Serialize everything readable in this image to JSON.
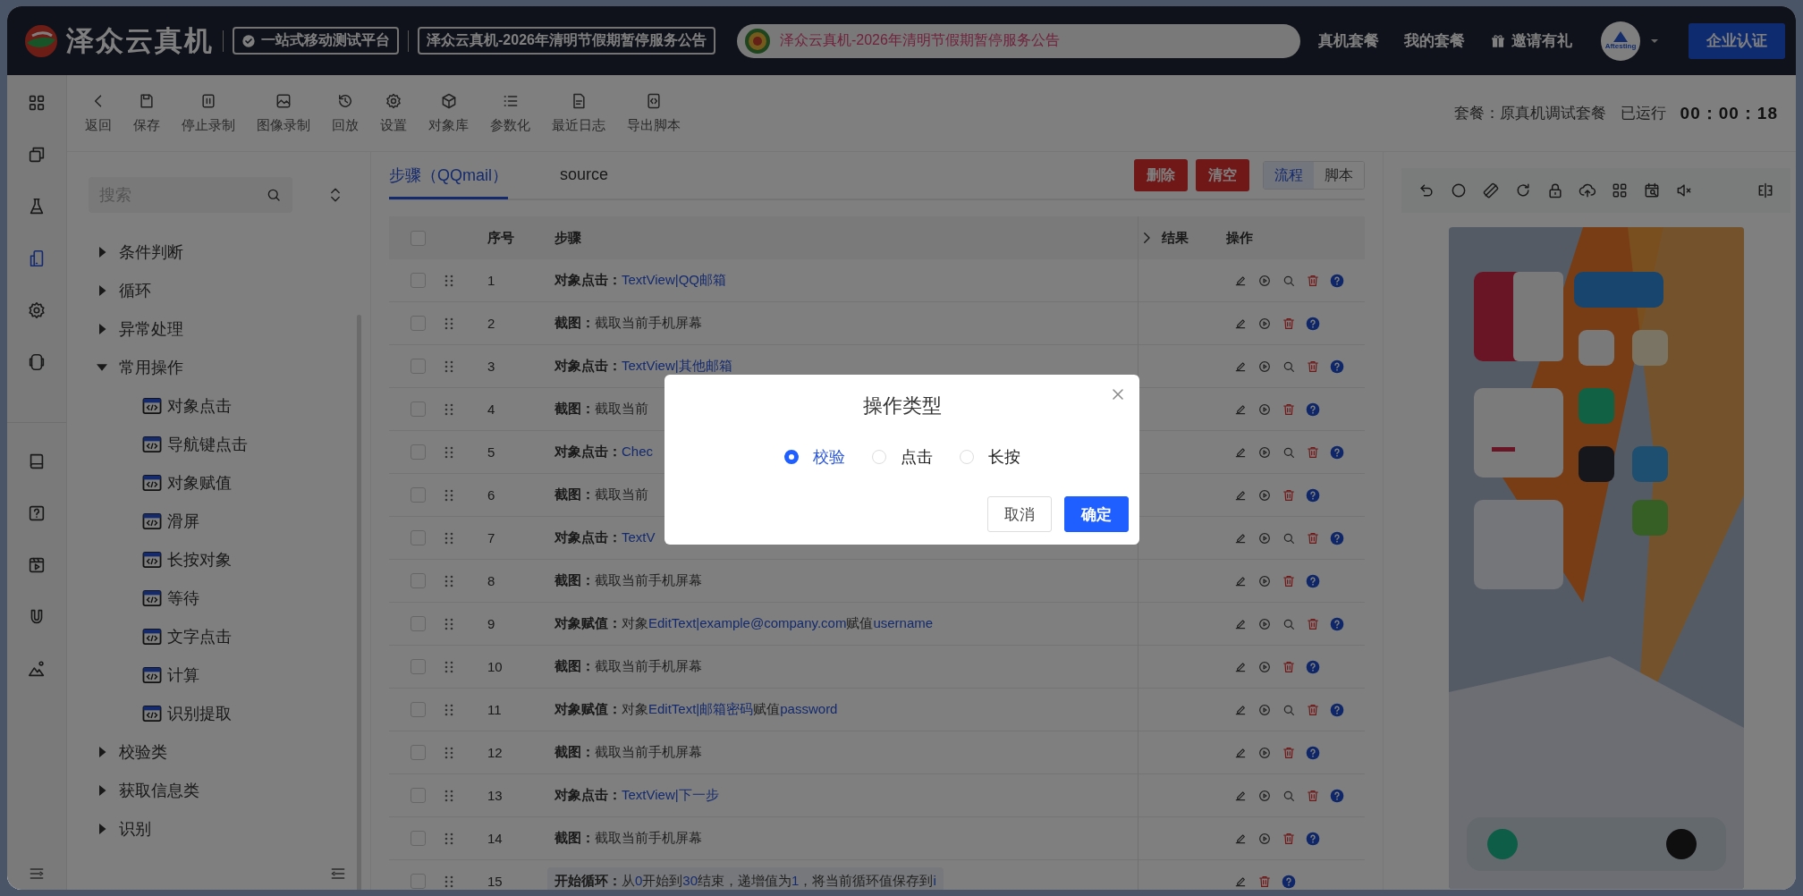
{
  "header": {
    "logo": "泽众云真机",
    "tagline": "一站式移动测试平台",
    "notice_badge": "泽众云真机-2026年清明节假期暂停服务公告",
    "announcement": "泽众云真机-2026年清明节假期暂停服务公告",
    "nav": [
      "真机套餐",
      "我的套餐",
      "邀请有礼"
    ],
    "avatar": "Aftesting",
    "cta": "企业认证"
  },
  "rail": [
    {
      "selected": false
    },
    {
      "selected": false
    },
    {
      "selected": false
    },
    {
      "selected": true
    },
    {
      "selected": false
    },
    {
      "selected": false
    },
    {
      "selected": false
    },
    {
      "selected": false
    },
    {
      "selected": false
    },
    {
      "selected": false
    },
    {
      "selected": false
    }
  ],
  "toolbar": {
    "items": [
      "返回",
      "保存",
      "停止录制",
      "图像录制",
      "回放",
      "设置",
      "对象库",
      "参数化",
      "最近日志",
      "导出脚本"
    ],
    "plan": "套餐：原真机调试套餐",
    "runtime_label": "已运行",
    "runtime": "00：00：18"
  },
  "tree": {
    "search": {
      "placeholder": "搜索"
    },
    "items": [
      {
        "label": "条件判断",
        "expanded": false
      },
      {
        "label": "循环",
        "expanded": false
      },
      {
        "label": "异常处理",
        "expanded": false
      },
      {
        "label": "常用操作",
        "expanded": true,
        "children": [
          {
            "label": "对象点击"
          },
          {
            "label": "导航键点击"
          },
          {
            "label": "对象赋值"
          },
          {
            "label": "滑屏"
          },
          {
            "label": "长按对象"
          },
          {
            "label": "等待"
          },
          {
            "label": "文字点击"
          },
          {
            "label": "计算"
          },
          {
            "label": "识别提取"
          }
        ]
      },
      {
        "label": "校验类",
        "expanded": false
      },
      {
        "label": "获取信息类",
        "expanded": false
      },
      {
        "label": "识别",
        "expanded": false
      }
    ]
  },
  "editor": {
    "tabs": [
      {
        "label": "步骤（QQmail）",
        "selected": true
      },
      {
        "label": "source",
        "selected": false
      }
    ],
    "buttons": [
      "删除",
      "清空"
    ],
    "modes": [
      {
        "label": "流程",
        "selected": true
      },
      {
        "label": "脚本",
        "selected": false
      }
    ],
    "select_all_checked": false,
    "columns": [
      "序号",
      "步骤",
      "结果",
      "操作"
    ],
    "rows": [
      {
        "no": "1",
        "checked": false,
        "kind": "step",
        "label": "对象点击：",
        "parts": [
          {
            "text": "TextView|QQ邮箱",
            "value": true
          }
        ],
        "run": true,
        "find": true
      },
      {
        "no": "2",
        "checked": false,
        "kind": "step",
        "label": "截图：",
        "parts": [
          {
            "text": "截取当前手机屏幕",
            "value": false
          }
        ],
        "run": true,
        "find": false
      },
      {
        "no": "3",
        "checked": false,
        "kind": "step",
        "label": "对象点击：",
        "parts": [
          {
            "text": "TextView|其他邮箱",
            "value": true
          }
        ],
        "run": true,
        "find": true
      },
      {
        "no": "4",
        "checked": false,
        "kind": "step",
        "label": "截图：",
        "parts": [
          {
            "text": "截取当前",
            "value": false
          }
        ],
        "run": true,
        "find": false
      },
      {
        "no": "5",
        "checked": false,
        "kind": "step",
        "label": "对象点击：",
        "parts": [
          {
            "text": "Chec",
            "value": true
          }
        ],
        "run": true,
        "find": true
      },
      {
        "no": "6",
        "checked": false,
        "kind": "step",
        "label": "截图：",
        "parts": [
          {
            "text": "截取当前",
            "value": false
          }
        ],
        "run": true,
        "find": false
      },
      {
        "no": "7",
        "checked": false,
        "kind": "step",
        "label": "对象点击：",
        "parts": [
          {
            "text": "TextV",
            "value": true
          }
        ],
        "run": true,
        "find": true
      },
      {
        "no": "8",
        "checked": false,
        "kind": "step",
        "label": "截图：",
        "parts": [
          {
            "text": "截取当前手机屏幕",
            "value": false
          }
        ],
        "run": true,
        "find": false
      },
      {
        "no": "9",
        "checked": false,
        "kind": "step",
        "label": "对象赋值：",
        "parts": [
          {
            "text": "对象",
            "value": false
          },
          {
            "text": "EditText|example@company.com",
            "value": true
          },
          {
            "text": "赋值",
            "value": false
          },
          {
            "text": "username",
            "value": true
          }
        ],
        "run": true,
        "find": true
      },
      {
        "no": "10",
        "checked": false,
        "kind": "step",
        "label": "截图：",
        "parts": [
          {
            "text": "截取当前手机屏幕",
            "value": false
          }
        ],
        "run": true,
        "find": false
      },
      {
        "no": "11",
        "checked": false,
        "kind": "step",
        "label": "对象赋值：",
        "parts": [
          {
            "text": "对象",
            "value": false
          },
          {
            "text": "EditText|邮箱密码",
            "value": true
          },
          {
            "text": "赋值",
            "value": false
          },
          {
            "text": "password",
            "value": true
          }
        ],
        "run": true,
        "find": true
      },
      {
        "no": "12",
        "checked": false,
        "kind": "step",
        "label": "截图：",
        "parts": [
          {
            "text": "截取当前手机屏幕",
            "value": false
          }
        ],
        "run": true,
        "find": false
      },
      {
        "no": "13",
        "checked": false,
        "kind": "step",
        "label": "对象点击：",
        "parts": [
          {
            "text": "TextView|下一步",
            "value": true
          }
        ],
        "run": true,
        "find": true
      },
      {
        "no": "14",
        "checked": false,
        "kind": "step",
        "label": "截图：",
        "parts": [
          {
            "text": "截取当前手机屏幕",
            "value": false
          }
        ],
        "run": true,
        "find": false
      },
      {
        "no": "15",
        "checked": false,
        "kind": "loop",
        "label": "开始循环：",
        "parts": [
          {
            "text": "从",
            "value": false
          },
          {
            "text": "0",
            "value": true
          },
          {
            "text": "开始到",
            "value": false
          },
          {
            "text": "30",
            "value": true
          },
          {
            "text": "结束，递增值为",
            "value": false
          },
          {
            "text": "1",
            "value": true
          },
          {
            "text": "，将当前循环值保存到",
            "value": false
          },
          {
            "text": "i",
            "value": true
          }
        ],
        "run": false,
        "find": false
      }
    ]
  },
  "dialog": {
    "title": "操作类型",
    "options": [
      {
        "label": "校验",
        "selected": true
      },
      {
        "label": "点击",
        "selected": false
      },
      {
        "label": "长按",
        "selected": false
      }
    ],
    "buttons": [
      "取消",
      "确定"
    ]
  }
}
